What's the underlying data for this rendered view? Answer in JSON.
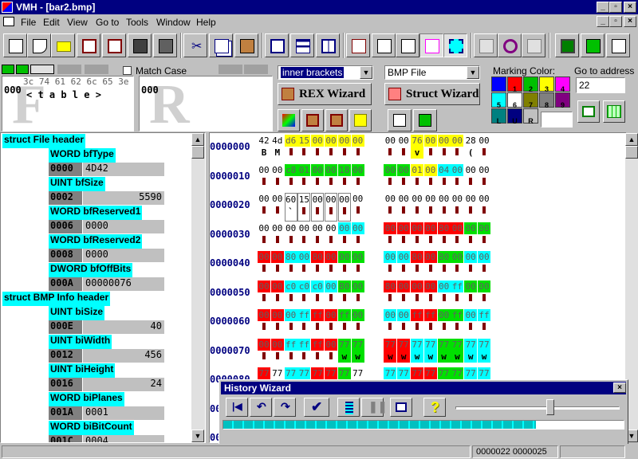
{
  "window": {
    "title": "VMH - [bar2.bmp]"
  },
  "menu": [
    "File",
    "Edit",
    "View",
    "Go to",
    "Tools",
    "Window",
    "Help"
  ],
  "find": {
    "match_case_label": "Match Case",
    "find_hex": "3c 74 61 62 6c 65 3e",
    "find_chars": "< t a b l e >",
    "find_offset": "000",
    "replace_offset": "000",
    "find_watermark": "F",
    "replace_watermark": "R"
  },
  "rex": {
    "dropdown_value": "inner brackets",
    "button_label": "REX Wizard"
  },
  "struct": {
    "dropdown_value": "BMP File",
    "button_label": "Struct Wizard"
  },
  "marking": {
    "label": "Marking Color:",
    "colors": [
      {
        "n": "",
        "c": "#0000ff"
      },
      {
        "n": "1",
        "c": "#ff0000"
      },
      {
        "n": "2",
        "c": "#00c000"
      },
      {
        "n": "3",
        "c": "#ffff00"
      },
      {
        "n": "4",
        "c": "#ff00ff"
      },
      {
        "n": "5",
        "c": "#00ffff"
      },
      {
        "n": "6",
        "c": "#ffffff"
      },
      {
        "n": "7",
        "c": "#808000"
      },
      {
        "n": "8",
        "c": "#808080"
      },
      {
        "n": "9",
        "c": "#800080"
      },
      {
        "n": "L",
        "c": "#008080"
      },
      {
        "n": "U",
        "c": "#000080"
      },
      {
        "n": "R",
        "c": "#c0c0c0"
      }
    ]
  },
  "goto": {
    "label": "Go to address",
    "value": "22"
  },
  "left": {
    "rows": [
      {
        "t": "header",
        "label": "struct File header"
      },
      {
        "t": "field",
        "label": "WORD bfType"
      },
      {
        "t": "val",
        "off": "0000",
        "val": "4D42",
        "align": "left"
      },
      {
        "t": "field",
        "label": "UINT bfSize"
      },
      {
        "t": "val",
        "off": "0002",
        "val": "5590",
        "align": "right"
      },
      {
        "t": "field",
        "label": "WORD bfReserved1"
      },
      {
        "t": "val",
        "off": "0006",
        "val": "0000",
        "align": "left"
      },
      {
        "t": "field",
        "label": "WORD bfReserved2"
      },
      {
        "t": "val",
        "off": "0008",
        "val": "0000",
        "align": "left"
      },
      {
        "t": "field",
        "label": "DWORD bfOffBits"
      },
      {
        "t": "val",
        "off": "000A",
        "val": "00000076",
        "align": "left"
      },
      {
        "t": "header",
        "label": "struct BMP Info header"
      },
      {
        "t": "field",
        "label": "UINT biSize"
      },
      {
        "t": "val",
        "off": "000E",
        "val": "40",
        "align": "right"
      },
      {
        "t": "field",
        "label": "UINT biWidth"
      },
      {
        "t": "val",
        "off": "0012",
        "val": "456",
        "align": "right"
      },
      {
        "t": "field",
        "label": "UINT biHeight"
      },
      {
        "t": "val",
        "off": "0016",
        "val": "24",
        "align": "right"
      },
      {
        "t": "field",
        "label": "WORD biPlanes"
      },
      {
        "t": "val",
        "off": "001A",
        "val": "0001",
        "align": "left"
      },
      {
        "t": "field",
        "label": "WORD biBitCount"
      },
      {
        "t": "val",
        "off": "001C",
        "val": "0004",
        "align": "left"
      }
    ]
  },
  "hex": {
    "addresses": [
      "0000000",
      "0000010",
      "0000020",
      "0000030",
      "0000040",
      "0000050",
      "0000060",
      "0000070",
      "0000080",
      "0000090",
      "00000A0"
    ],
    "rows": [
      {
        "b": [
          "42",
          "4d",
          "d6",
          "15",
          "00",
          "00",
          "00",
          "00",
          "00",
          "00",
          "76",
          "00",
          "00",
          "00",
          "28",
          "00"
        ],
        "c": [
          "B",
          "M",
          "",
          "",
          "",
          "",
          "",
          "",
          "",
          "",
          "v",
          "",
          "",
          "",
          "(",
          ""
        ],
        "bg": [
          "",
          "",
          "y",
          "y",
          "y",
          "y",
          "y",
          "y",
          "",
          "",
          "y",
          "y",
          "y",
          "y",
          "",
          ""
        ]
      },
      {
        "b": [
          "00",
          "00",
          "c8",
          "01",
          "00",
          "00",
          "18",
          "00",
          "00",
          "00",
          "01",
          "00",
          "04",
          "00",
          "00",
          "00"
        ],
        "c": [
          "",
          "",
          "",
          "",
          "",
          "",
          "",
          "",
          "",
          "",
          "",
          "",
          "",
          "",
          "",
          ""
        ],
        "bg": [
          "",
          "",
          "g",
          "g",
          "g",
          "g",
          "g",
          "g",
          "g",
          "g",
          "y",
          "y",
          "c",
          "c",
          "",
          ""
        ]
      },
      {
        "b": [
          "00",
          "00",
          "60",
          "15",
          "00",
          "00",
          "00",
          "00",
          "00",
          "00",
          "00",
          "00",
          "00",
          "00",
          "00",
          "00"
        ],
        "c": [
          "",
          "",
          "`",
          "",
          "",
          "",
          "",
          "",
          "",
          "",
          "",
          "",
          "",
          "",
          "",
          ""
        ],
        "bg": [
          "",
          "",
          "box",
          "box",
          "box",
          "box",
          "box",
          "",
          "",
          "",
          "",
          "",
          "",
          "",
          "",
          ""
        ]
      },
      {
        "b": [
          "00",
          "00",
          "00",
          "00",
          "00",
          "00",
          "00",
          "00",
          "00",
          "00",
          "00",
          "00",
          "80",
          "00",
          "00",
          "00"
        ],
        "c": [
          "",
          "",
          "",
          "",
          "",
          "",
          "",
          "",
          "",
          "",
          "",
          "",
          "",
          "",
          "",
          ""
        ],
        "bg": [
          "",
          "",
          "",
          "",
          "",
          "",
          "c",
          "c",
          "r",
          "r",
          "r",
          "r",
          "r",
          "r",
          "g",
          "g"
        ]
      },
      {
        "b": [
          "00",
          "00",
          "80",
          "00",
          "80",
          "00",
          "00",
          "00",
          "00",
          "00",
          "80",
          "00",
          "80",
          "00",
          "00",
          "00"
        ],
        "c": [
          "",
          "",
          "",
          "",
          "",
          "",
          "",
          "",
          "",
          "",
          "",
          "",
          "",
          "",
          "",
          ""
        ],
        "bg": [
          "r",
          "r",
          "c",
          "c",
          "r",
          "r",
          "g",
          "g",
          "c",
          "c",
          "r",
          "r",
          "g",
          "g",
          "c",
          "c"
        ]
      },
      {
        "b": [
          "00",
          "00",
          "c0",
          "c0",
          "c0",
          "00",
          "80",
          "00",
          "80",
          "00",
          "00",
          "00",
          "00",
          "ff",
          "00",
          "00"
        ],
        "c": [
          "",
          "",
          "",
          "",
          "",
          "",
          "",
          "",
          "",
          "",
          "",
          "",
          "",
          "",
          "",
          ""
        ],
        "bg": [
          "r",
          "r",
          "c",
          "c",
          "c",
          "c",
          "g",
          "g",
          "r",
          "r",
          "r",
          "r",
          "c",
          "c",
          "g",
          "g"
        ]
      },
      {
        "b": [
          "00",
          "00",
          "00",
          "ff",
          "ff",
          "00",
          "ff",
          "00",
          "00",
          "00",
          "ff",
          "ff",
          "00",
          "ff",
          "00",
          "ff"
        ],
        "c": [
          "",
          "",
          "",
          "",
          "",
          "",
          "",
          "",
          "",
          "",
          "",
          "",
          "",
          "",
          "",
          ""
        ],
        "bg": [
          "r",
          "r",
          "c",
          "c",
          "r",
          "r",
          "g",
          "g",
          "c",
          "c",
          "r",
          "r",
          "g",
          "g",
          "c",
          "c"
        ]
      },
      {
        "b": [
          "00",
          "00",
          "ff",
          "ff",
          "ff",
          "00",
          "77",
          "77",
          "77",
          "77",
          "77",
          "77",
          "77",
          "77",
          "77",
          "77"
        ],
        "c": [
          "",
          "",
          "",
          "",
          "",
          "",
          "w",
          "w",
          "w",
          "w",
          "w",
          "w",
          "w",
          "w",
          "w",
          "w"
        ],
        "bg": [
          "r",
          "r",
          "c",
          "c",
          "r",
          "r",
          "g",
          "g",
          "r",
          "r",
          "c",
          "c",
          "g",
          "g",
          "c",
          "c"
        ]
      },
      {
        "b": [
          "77",
          "77",
          "77",
          "77",
          "77",
          "77",
          "77",
          "77",
          "77",
          "77",
          "77",
          "77",
          "77",
          "77",
          "77",
          "77"
        ],
        "c": [
          "",
          "",
          "",
          "",
          "",
          "",
          "",
          "",
          "",
          "",
          "",
          "",
          "",
          "",
          "",
          ""
        ],
        "bg": [
          "r",
          "",
          "c",
          "c",
          "r",
          "r",
          "g",
          "",
          "c",
          "c",
          "r",
          "r",
          "g",
          "g",
          "c",
          "c"
        ]
      }
    ]
  },
  "history": {
    "title": "History Wizard",
    "slider_fraction": 0.58
  },
  "status": {
    "left": "",
    "middle": "0000022 0000025",
    "right": ""
  }
}
